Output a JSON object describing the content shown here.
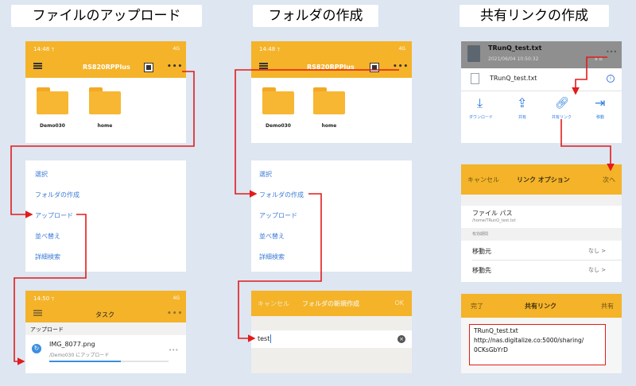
{
  "titles": {
    "upload": "ファイルのアップロード",
    "create_folder": "フォルダの作成",
    "share_link": "共有リンクの作成"
  },
  "upload_panel": {
    "time": "14:48 ⁊",
    "signal": "4G",
    "app_title": "RS820RPPlus",
    "folders": [
      "Demo030",
      "home"
    ]
  },
  "folder_panel": {
    "time": "14:48 ⁊",
    "signal": "4G",
    "app_title": "RS820RPPlus",
    "folders": [
      "Demo030",
      "home"
    ]
  },
  "menu": {
    "items": [
      "選択",
      "フォルダの作成",
      "アップロード",
      "並べ替え",
      "詳細検索"
    ]
  },
  "task_panel": {
    "time": "14:50 ⁊",
    "signal": "4G",
    "title": "タスク",
    "section": "アップロード",
    "file_name": "IMG_8077.png",
    "file_sub": "/Demo030 にアップロード",
    "progress": 0.6
  },
  "new_folder_dialog": {
    "cancel": "キャンセル",
    "title": "フォルダの新規作成",
    "ok": "OK",
    "value": "test"
  },
  "share_top": {
    "file_name": "TRunQ_test.txt",
    "date": "2021/06/04 10:50:32",
    "size": "8 B",
    "detail_name": "TRunQ_test.txt",
    "actions": [
      "ダウンロード",
      "共有",
      "共有リンク",
      "移動"
    ]
  },
  "link_options": {
    "cancel": "キャンセル",
    "title": "リンク オプション",
    "next": "次へ",
    "path_label": "ファイル パス",
    "path_value": "/home/TRunQ_test.txt",
    "section": "有効期間",
    "rows": [
      {
        "label": "移動元",
        "value": "なし >"
      },
      {
        "label": "移動先",
        "value": "なし >"
      }
    ]
  },
  "share_link_panel": {
    "done": "完了",
    "title": "共有リンク",
    "share": "共有",
    "file": "TRunQ_test.txt",
    "url_line1": "http://nas.digitalize.co:5000/sharing/",
    "url_line2": "0CKsGbYrD"
  },
  "colors": {
    "header": "#f4b329",
    "link_blue": "#3b7bd6",
    "annotation_red": "#e21b1b",
    "background": "#dde6f1"
  }
}
